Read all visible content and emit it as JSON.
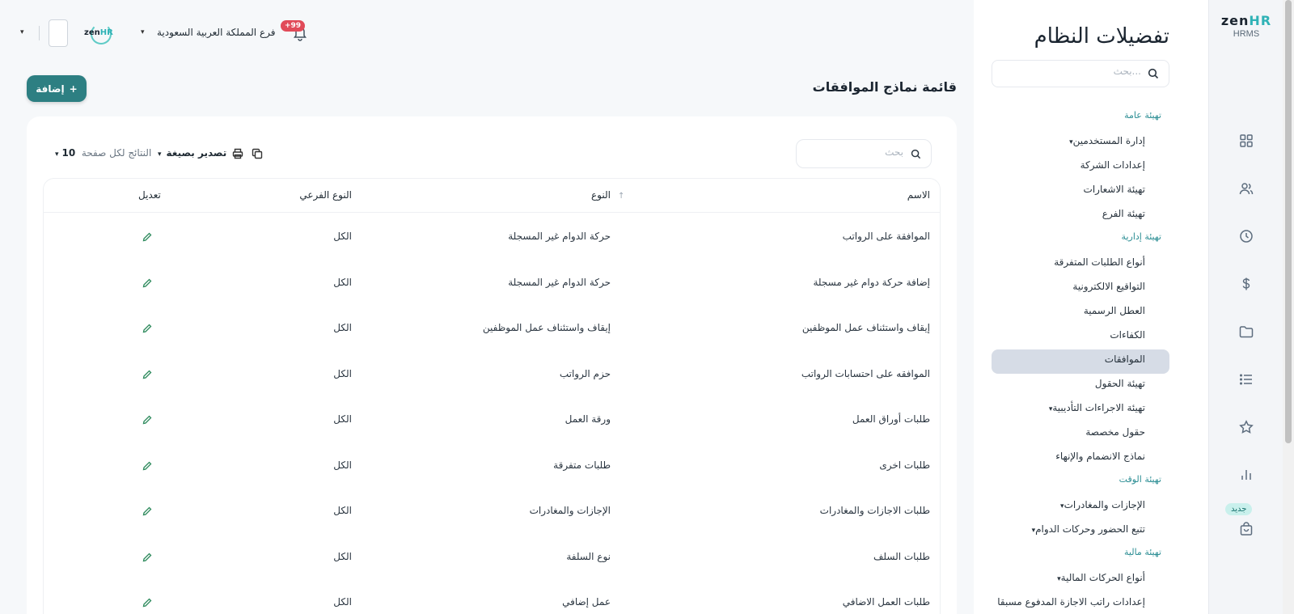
{
  "rail": {
    "logo_zen": "zen",
    "logo_hr": "HR",
    "logo_sub": "HRMS",
    "new_badge": "جديد",
    "icons": [
      "grid-icon",
      "users-icon",
      "clock-icon",
      "dollar-icon",
      "folder-icon",
      "list-icon",
      "star-icon",
      "bar-chart-icon",
      "bag-icon"
    ]
  },
  "settings": {
    "title": "تفضيلات النظام",
    "search_placeholder": "بحث...",
    "sections": [
      {
        "label": "تهيئة عامة"
      },
      {
        "label": "تهيئة إدارية"
      },
      {
        "label": "تهيئة الوقت"
      },
      {
        "label": "تهيئة مالية"
      }
    ],
    "items": [
      {
        "label": "إدارة المستخدمين",
        "expandable": true
      },
      {
        "label": "إعدادات الشركة"
      },
      {
        "label": "تهيئة الاشعارات"
      },
      {
        "label": "تهيئة الفرع"
      },
      {
        "label": "أنواع الطلبات المتفرقة"
      },
      {
        "label": "التواقيع الالكترونية"
      },
      {
        "label": "العطل الرسمية"
      },
      {
        "label": "الكفاءات"
      },
      {
        "label": "الموافقات",
        "active": true
      },
      {
        "label": "تهيئة الحقول"
      },
      {
        "label": "تهيئة الاجراءات التأديبية",
        "expandable": true
      },
      {
        "label": "حقول مخصصة"
      },
      {
        "label": "نماذج الانضمام والإنهاء"
      },
      {
        "label": "الإجازات والمغادرات",
        "expandable": true
      },
      {
        "label": "تتبع الحضور وحركات الدوام",
        "expandable": true
      },
      {
        "label": "أنواع الحركات المالية",
        "expandable": true
      },
      {
        "label": "إعدادات راتب الاجازة المدفوع مسبقا"
      }
    ]
  },
  "topbar": {
    "notification_count": "+99",
    "branch": "فرع المملكة العربية السعودية",
    "logo_zen": "zen",
    "logo_hr": "HR"
  },
  "page": {
    "title": "قائمة نماذج الموافقات",
    "add_label": "إضافة"
  },
  "toolbar": {
    "search_placeholder": "بحث",
    "export_label": "تصدير بصيغة",
    "per_page_value": "10",
    "per_page_label": "النتائج لكل صفحة"
  },
  "table": {
    "headers": {
      "name": "الاسم",
      "type": "النوع",
      "subtype": "النوع الفرعي",
      "edit": "تعديل"
    },
    "rows": [
      {
        "name": "الموافقة على الرواتب",
        "type": "حركة الدوام غير المسجلة",
        "subtype": "الكل"
      },
      {
        "name": "إضافة حركة دوام غير مسجلة",
        "type": "حركة الدوام غير المسجلة",
        "subtype": "الكل"
      },
      {
        "name": "إيقاف واستئناف عمل الموظفين",
        "type": "إيقاف واستئناف عمل الموظفين",
        "subtype": "الكل"
      },
      {
        "name": "الموافقه على احتسابات الرواتب",
        "type": "حزم الرواتب",
        "subtype": "الكل"
      },
      {
        "name": "طلبات أوراق العمل",
        "type": "ورقة العمل",
        "subtype": "الكل"
      },
      {
        "name": "طلبات اخرى",
        "type": "طلبات متفرقة",
        "subtype": "الكل"
      },
      {
        "name": "طلبات الاجازات والمغادرات",
        "type": "الإجازات والمغادرات",
        "subtype": "الكل"
      },
      {
        "name": "طلبات السلف",
        "type": "نوع السلفة",
        "subtype": "الكل"
      },
      {
        "name": "طلبات العمل الاضافي",
        "type": "عمل إضافي",
        "subtype": "الكل"
      }
    ]
  },
  "colors": {
    "primary": "#2d7f82",
    "active_nav": "#d6dce6",
    "badge_red": "#e14b59",
    "section_teal": "#2a8d93"
  }
}
